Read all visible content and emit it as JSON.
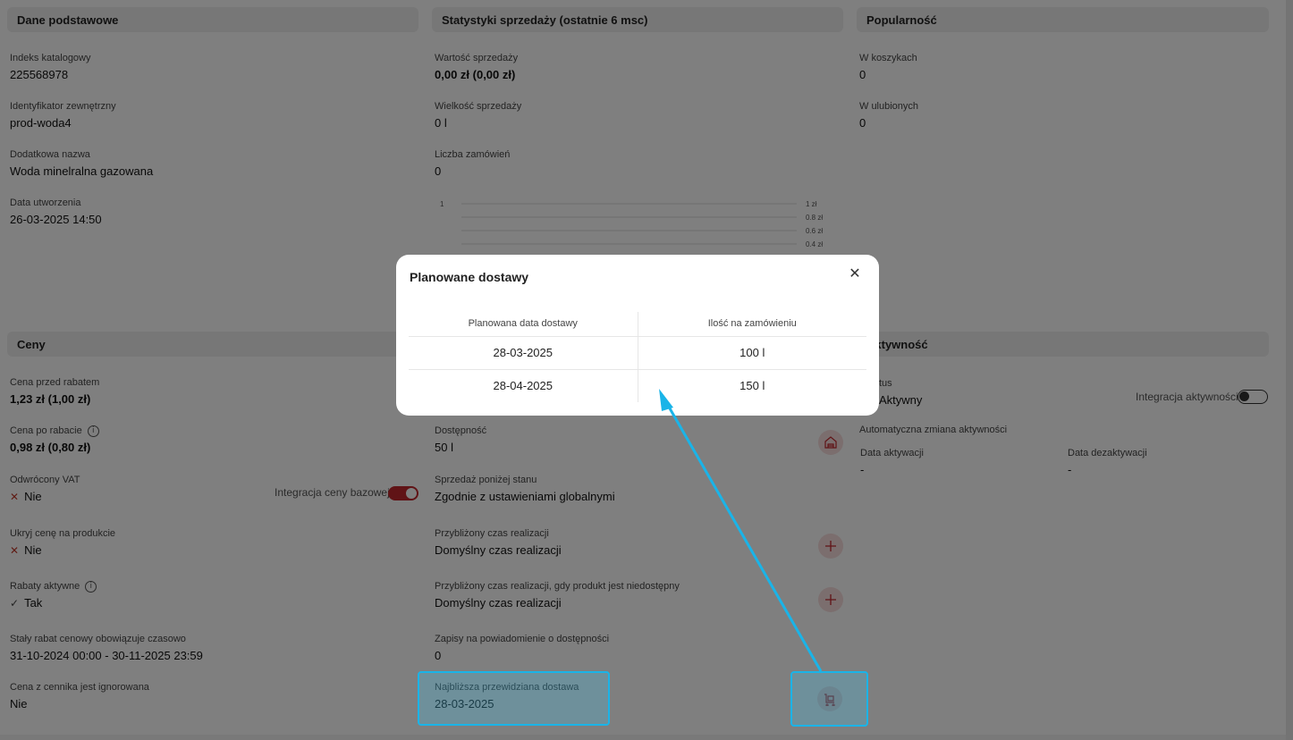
{
  "sections": {
    "basic": "Dane podstawowe",
    "sales": "Statystyki sprzedaży (ostatnie 6 msc)",
    "popularity": "Popularność",
    "prices": "Ceny",
    "activity": "Aktywność"
  },
  "basic": {
    "catalog_index_label": "Indeks katalogowy",
    "catalog_index": "225568978",
    "external_id_label": "Identyfikator zewnętrzny",
    "external_id": "prod-woda4",
    "extra_name_label": "Dodatkowa nazwa",
    "extra_name": "Woda minelralna gazowana",
    "created_label": "Data utworzenia",
    "created": "26-03-2025 14:50"
  },
  "sales": {
    "value_label": "Wartość sprzedaży",
    "value": "0,00 zł (0,00 zł)",
    "volume_label": "Wielkość sprzedaży",
    "volume": "0 l",
    "orders_label": "Liczba zamówień",
    "orders": "0"
  },
  "chart_data": {
    "type": "line",
    "left_tick": "1",
    "right_ticks": [
      "1 zł",
      "0.8 zł",
      "0.6 zł",
      "0.4 zł"
    ],
    "series": []
  },
  "popularity": {
    "carts_label": "W koszykach",
    "carts": "0",
    "favs_label": "W ulubionych",
    "favs": "0"
  },
  "prices": {
    "before_label": "Cena przed rabatem",
    "before": "1,23 zł (1,00 zł)",
    "after_label": "Cena po rabacie",
    "after": "0,98 zł (0,80 zł)",
    "vat_label": "Odwrócony VAT",
    "vat": "Nie",
    "base_price_integration": "Integracja ceny bazowej",
    "hide_label": "Ukryj cenę na produkcie",
    "hide": "Nie",
    "discounts_label": "Rabaty aktywne",
    "discounts": "Tak",
    "fixed_label": "Stały rabat cenowy obowiązuje czasowo",
    "fixed": "31-10-2024 00:00 - 30-11-2025 23:59",
    "ignored_label": "Cena z cennika jest ignorowana",
    "ignored": "Nie"
  },
  "stock": {
    "availability_label": "Dostępność",
    "availability": "50 l",
    "below_label": "Sprzedaż poniżej stanu",
    "below": "Zgodnie z ustawieniami globalnymi",
    "lead_label": "Przybliżony czas realizacji",
    "lead": "Domyślny czas realizacji",
    "lead_unavail_label": "Przybliżony czas realizacji, gdy produkt jest niedostępny",
    "lead_unavail": "Domyślny czas realizacji",
    "notify_label": "Zapisy na powiadomienie o dostępności",
    "notify": "0",
    "next_delivery_label": "Najbliższa przewidziana dostawa",
    "next_delivery": "28-03-2025"
  },
  "activity": {
    "status_label": "tus",
    "status": "Aktywny",
    "integration_label": "Integracja aktywności",
    "auto_label": "Automatyczna zmiana aktywności",
    "act_date_label": "Data aktywacji",
    "act_date": "-",
    "deact_date_label": "Data dezaktywacji",
    "deact_date": "-"
  },
  "modal": {
    "title": "Planowane dostawy",
    "columns": [
      "Planowana data dostawy",
      "Ilość na zamówieniu"
    ],
    "rows": [
      [
        "28-03-2025",
        "100 l"
      ],
      [
        "28-04-2025",
        "150 l"
      ]
    ]
  },
  "colors": {
    "accent": "#c1272d",
    "highlight": "#1ab4e8"
  }
}
